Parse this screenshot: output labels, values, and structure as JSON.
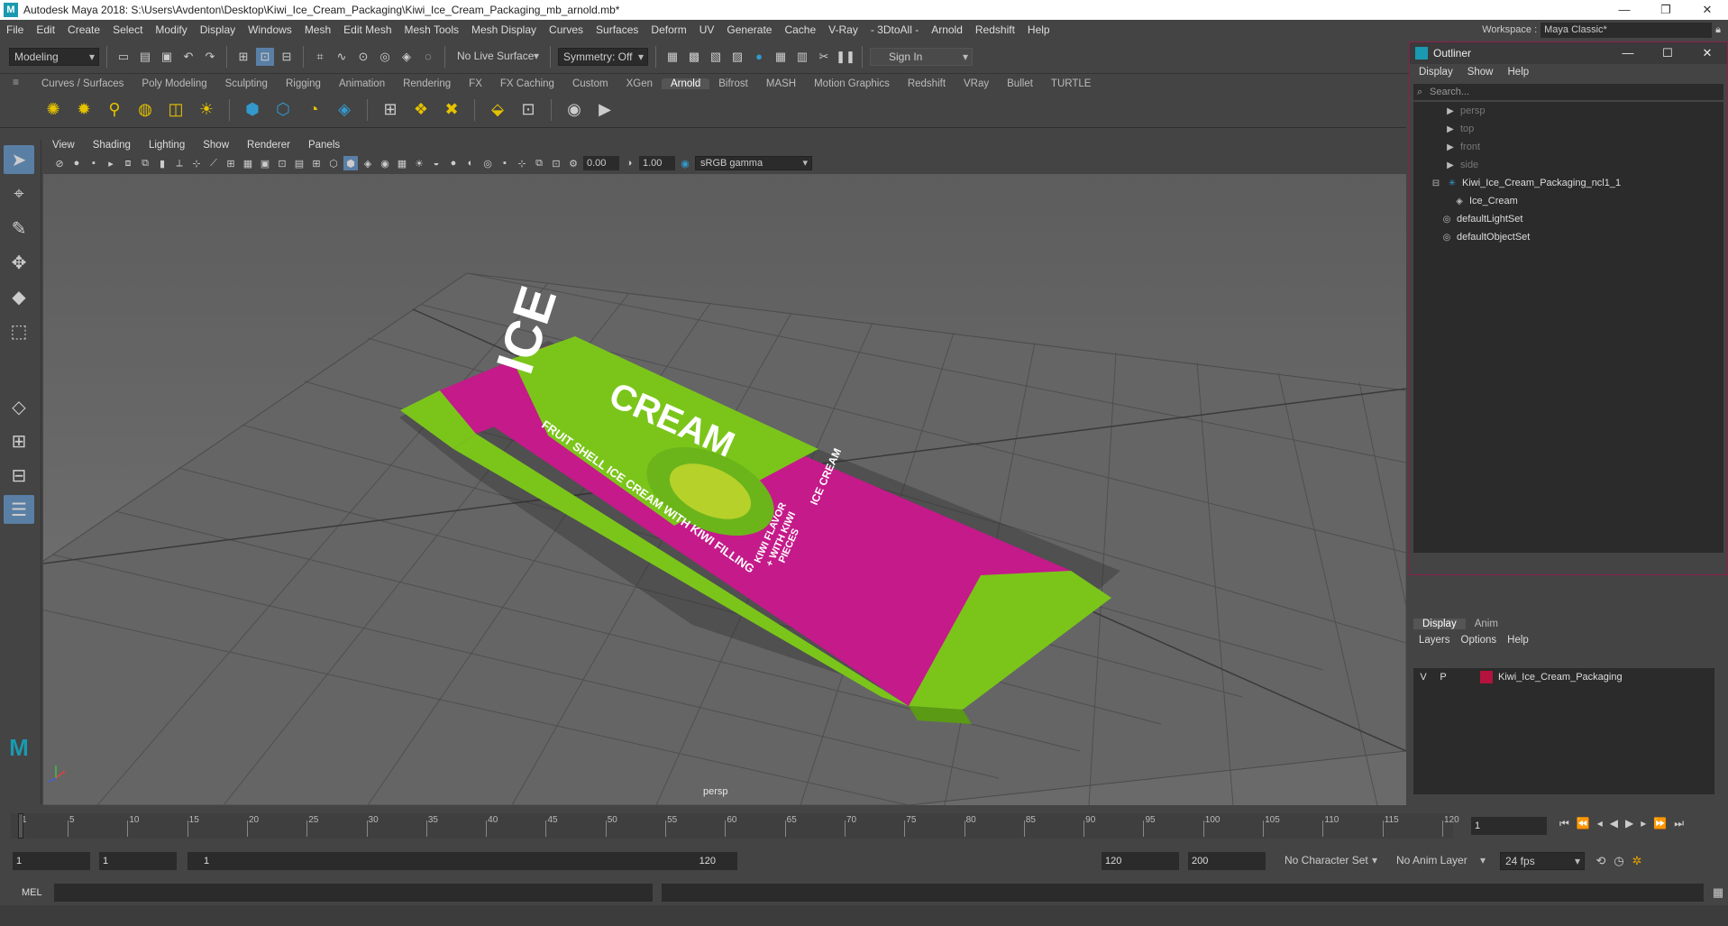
{
  "window": {
    "title": "Autodesk Maya 2018: S:\\Users\\Avdenton\\Desktop\\Kiwi_Ice_Cream_Packaging\\Kiwi_Ice_Cream_Packaging_mb_arnold.mb*",
    "min": "—",
    "max": "❐",
    "close": "✕"
  },
  "menu": [
    "File",
    "Edit",
    "Create",
    "Select",
    "Modify",
    "Display",
    "Windows",
    "Mesh",
    "Edit Mesh",
    "Mesh Tools",
    "Mesh Display",
    "Curves",
    "Surfaces",
    "Deform",
    "UV",
    "Generate",
    "Cache",
    "V-Ray",
    "- 3DtoAll -",
    "Arnold",
    "Redshift",
    "Help"
  ],
  "workspace": {
    "label": "Workspace :",
    "value": "Maya Classic*"
  },
  "status": {
    "mode": "Modeling",
    "live_surface": "No Live Surface",
    "symmetry": "Symmetry: Off",
    "sign_in": "Sign In"
  },
  "shelf_tabs": [
    "Curves / Surfaces",
    "Poly Modeling",
    "Sculpting",
    "Rigging",
    "Animation",
    "Rendering",
    "FX",
    "FX Caching",
    "Custom",
    "XGen",
    "Arnold",
    "Bifrost",
    "MASH",
    "Motion Graphics",
    "Redshift",
    "VRay",
    "Bullet",
    "TURTLE"
  ],
  "shelf_active": "Arnold",
  "panel_menu": [
    "View",
    "Shading",
    "Lighting",
    "Show",
    "Renderer",
    "Panels"
  ],
  "panel_toolbar": {
    "exposure": "0.00",
    "gamma": "1.00",
    "colorspace": "sRGB gamma"
  },
  "viewport": {
    "camera_label": "persp"
  },
  "package": {
    "brand_top": "ICE",
    "brand_main": "CREAM",
    "badge": "ICE CREAM",
    "flavor_line1": "KIWI FLAVOR",
    "flavor_line2": "+ WITH KIWI",
    "flavor_line3": "PIECES",
    "tagline1": "FRUIT SHELL ICE CREAM WITH KIWI FILLING"
  },
  "outliner": {
    "title": "Outliner",
    "menu": [
      "Display",
      "Show",
      "Help"
    ],
    "search_placeholder": "Search...",
    "items": [
      {
        "label": "persp",
        "dim": true
      },
      {
        "label": "top",
        "dim": true
      },
      {
        "label": "front",
        "dim": true
      },
      {
        "label": "side",
        "dim": true
      },
      {
        "label": "Kiwi_Ice_Cream_Packaging_ncl1_1",
        "dim": false
      },
      {
        "label": "Ice_Cream",
        "dim": false
      },
      {
        "label": "defaultLightSet",
        "dim": false
      },
      {
        "label": "defaultObjectSet",
        "dim": false
      }
    ]
  },
  "layers": {
    "tabs": [
      "Display",
      "Anim"
    ],
    "menu": [
      "Layers",
      "Options",
      "Help"
    ],
    "row": {
      "v": "V",
      "p": "P",
      "name": "Kiwi_Ice_Cream_Packaging",
      "color": "#b3133c"
    }
  },
  "timeline": {
    "ticks": [
      "1",
      "5",
      "10",
      "15",
      "20",
      "25",
      "30",
      "35",
      "40",
      "45",
      "50",
      "55",
      "60",
      "65",
      "70",
      "75",
      "80",
      "85",
      "90",
      "95",
      "100",
      "105",
      "110",
      "115",
      "120"
    ],
    "current": "1"
  },
  "range": {
    "start": "1",
    "playstart": "1",
    "slider_start": "1",
    "slider_end": "120",
    "playend": "120",
    "end": "200",
    "charset": "No Character Set",
    "animlayer": "No Anim Layer",
    "fps": "24 fps"
  },
  "cmd": {
    "label": "MEL"
  }
}
